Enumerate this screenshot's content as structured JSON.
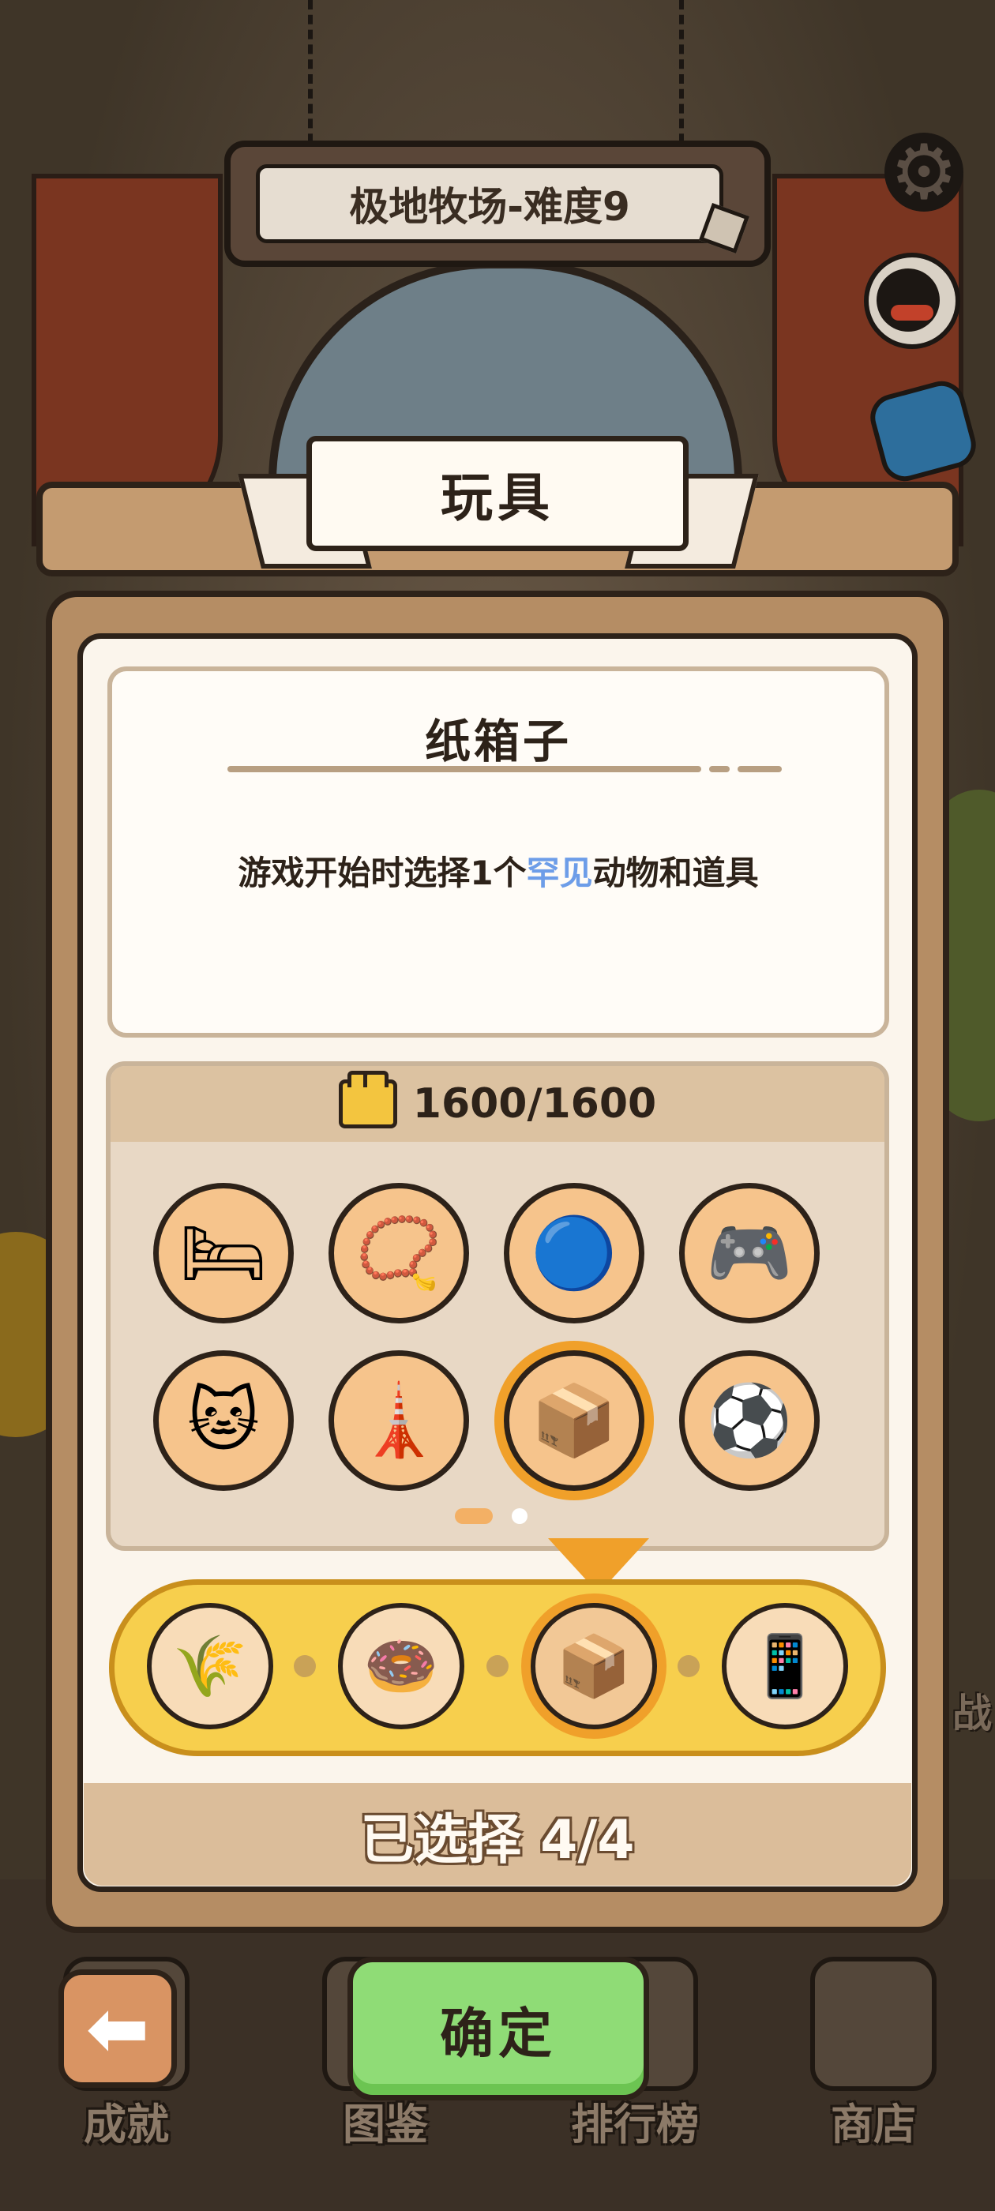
{
  "stage": {
    "title": "极地牧场-难度9"
  },
  "modal": {
    "title": "玩具",
    "item": {
      "name": "纸箱子",
      "desc_before": "游戏开始时选择1个",
      "desc_highlight": "罕见",
      "desc_after": "动物和道具"
    },
    "budget": "1600/1600",
    "toys": [
      {
        "icon": "cat-bed-icon",
        "glyph": "🛏"
      },
      {
        "icon": "collar-icon",
        "glyph": "📿"
      },
      {
        "icon": "toy-icon",
        "glyph": "🔵"
      },
      {
        "icon": "game-console-icon",
        "glyph": "🎮"
      },
      {
        "icon": "cat-doll-icon",
        "glyph": "🐱"
      },
      {
        "icon": "cat-tree-icon",
        "glyph": "🗼"
      },
      {
        "icon": "cardboard-box-icon",
        "glyph": "📦",
        "selected": true
      },
      {
        "icon": "ball-icon",
        "glyph": "⚽"
      }
    ],
    "pager": {
      "current": 1,
      "total": 2
    },
    "selected_slots": [
      {
        "icon": "grass-icon",
        "glyph": "🌾"
      },
      {
        "icon": "donut-icon",
        "glyph": "🍩"
      },
      {
        "icon": "cardboard-box-icon",
        "glyph": "📦",
        "active": true
      },
      {
        "icon": "phone-icon",
        "glyph": "📱"
      }
    ],
    "selected_status": "已选择 4/4",
    "confirm_label": "确定"
  },
  "bottom_nav": [
    {
      "label": "成就",
      "icon": "trophy-icon"
    },
    {
      "label": "图鉴",
      "icon": "book-icon"
    },
    {
      "label": "排行榜",
      "icon": "leaderboard-icon"
    },
    {
      "label": "商店",
      "icon": "shop-icon"
    }
  ],
  "side_partial_label": "战",
  "colors": {
    "highlight": "#6d9de8",
    "accent": "#f0a02a",
    "confirm": "#8fdc76"
  }
}
